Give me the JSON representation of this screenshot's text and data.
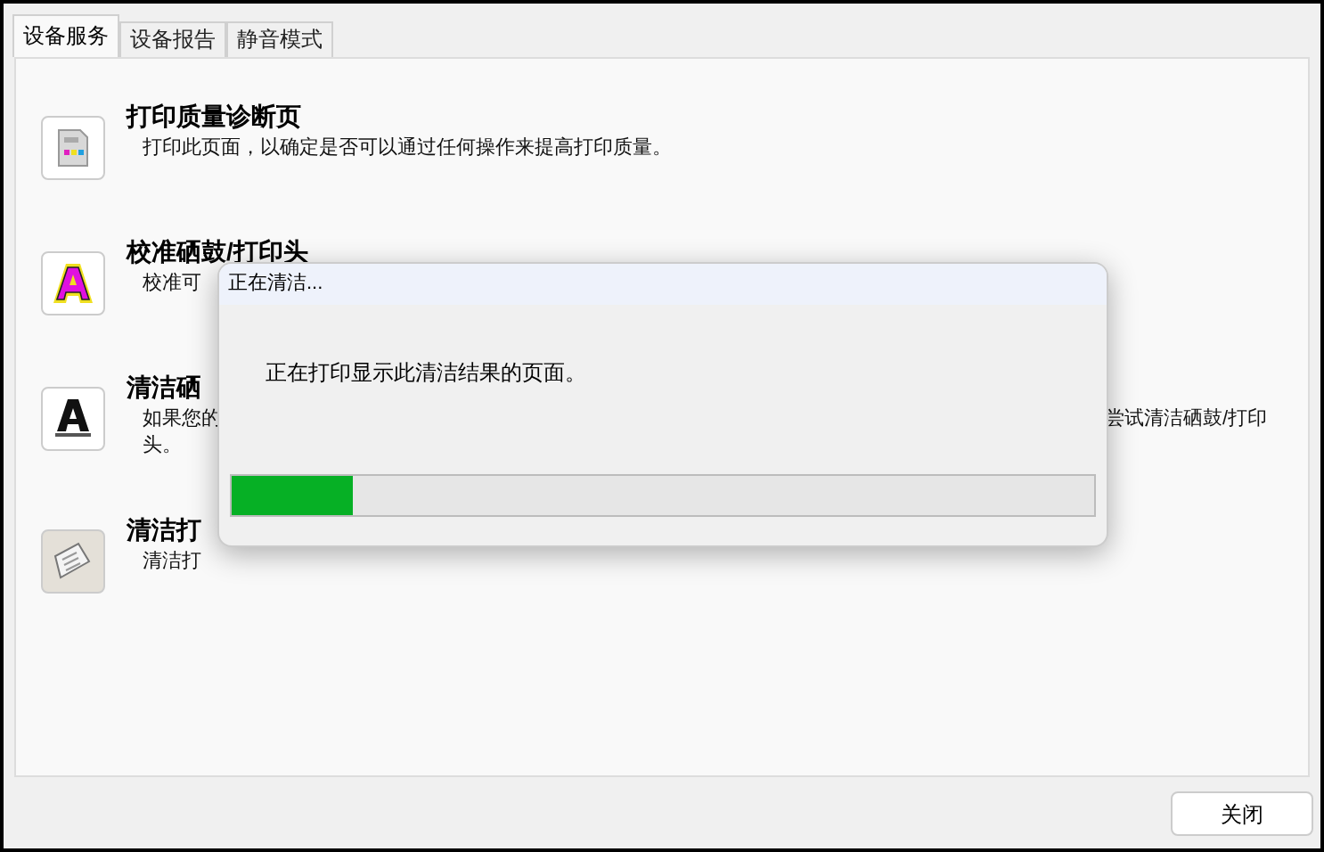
{
  "tabs": [
    {
      "label": "设备服务",
      "selected": true
    },
    {
      "label": "设备报告",
      "selected": false
    },
    {
      "label": "静音模式",
      "selected": false
    }
  ],
  "services": [
    {
      "kind": "diagnostic",
      "title": "打印质量诊断页",
      "description": "打印此页面，以确定是否可以通过任何操作来提高打印质量。"
    },
    {
      "kind": "align",
      "title": "校准硒鼓/打印头",
      "description": "校准可"
    },
    {
      "kind": "clean",
      "title": "清洁硒",
      "description": "如果您的",
      "description_tail": "尝试清洁硒鼓/打印",
      "description_line2": "头。"
    },
    {
      "kind": "cleanpage",
      "title": "清洁打",
      "description": "清洁打"
    }
  ],
  "dialog": {
    "title": "正在清洁...",
    "message": "正在打印显示此清洁结果的页面。",
    "level": 0.14
  },
  "close_button": "关闭"
}
